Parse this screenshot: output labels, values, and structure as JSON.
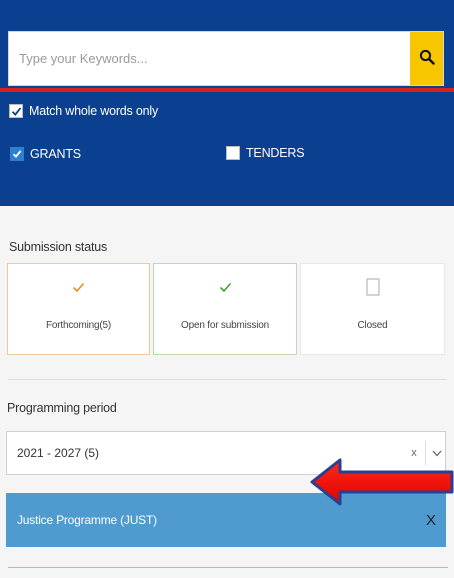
{
  "search": {
    "placeholder": "Type your Keywords...",
    "value": ""
  },
  "match_whole_words": {
    "label": "Match whole words only",
    "checked": true
  },
  "type_filters": {
    "grants": {
      "label": "GRANTS",
      "checked": true
    },
    "tenders": {
      "label": "TENDERS",
      "checked": false
    }
  },
  "submission_status": {
    "label": "Submission status",
    "options": [
      {
        "label": "Forthcoming(5)",
        "checked": true,
        "mark_color": "#e88a2c"
      },
      {
        "label": "Open for submission",
        "checked": true,
        "mark_color": "#4a9a3c"
      },
      {
        "label": "Closed",
        "checked": false,
        "mark_color": "#999999"
      }
    ]
  },
  "programming_period": {
    "label": "Programming period",
    "selected": "2021 - 2027 (5)",
    "clear": "x"
  },
  "programme_chip": {
    "label": "Justice Programme (JUST)",
    "close": "X"
  },
  "colors": {
    "panel_blue": "#0b3f8f",
    "search_button_yellow": "#f7c600",
    "accent_red": "#d7211a",
    "chip_blue": "#4f9bd0",
    "check_blue": "#2d7fd3"
  },
  "icons": {
    "search": "search-icon",
    "check": "checkmark-icon",
    "dropdown": "chevron-down-icon",
    "annotation": "arrow-left-icon"
  }
}
